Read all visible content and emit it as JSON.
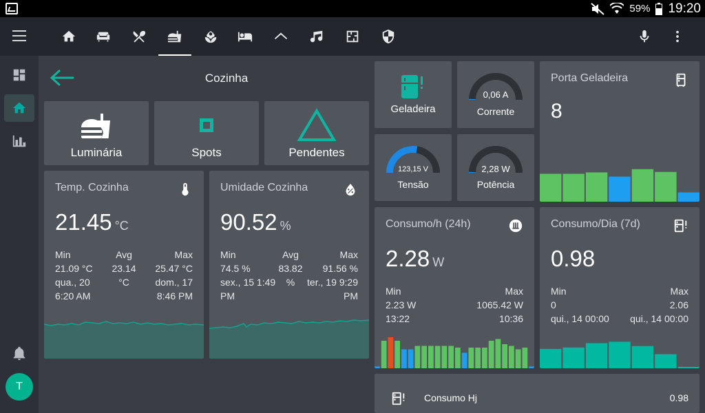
{
  "status_bar": {
    "battery": "59%",
    "time": "19:20"
  },
  "nav": {
    "tabs": [
      "home-icon",
      "sofa-icon",
      "fork-knife-icon",
      "food-drink-icon",
      "flower-icon",
      "bed-icon",
      "roof-icon",
      "music-icon",
      "floorplan-icon",
      "shield-icon"
    ],
    "active_tab": "food-drink-icon"
  },
  "sidebar": {
    "items": [
      "dashboard-icon",
      "home-icon",
      "chart-icon"
    ],
    "user_initial": "T"
  },
  "view": {
    "title": "Cozinha"
  },
  "lights": [
    {
      "label": "Luminária",
      "icon": "food-drink-icon"
    },
    {
      "label": "Spots",
      "icon": "square-icon"
    },
    {
      "label": "Pendentes",
      "icon": "triangle-icon"
    }
  ],
  "temp": {
    "title": "Temp. Cozinha",
    "value": "21.45",
    "unit": "°C",
    "min_label": "Min",
    "avg_label": "Avg",
    "max_label": "Max",
    "min_value": "21.09 °C",
    "min_date": "qua., 20",
    "min_time": "6:20 AM",
    "avg_value": "23.14",
    "avg_unit": "°C",
    "max_value": "25.47 °C",
    "max_date": "dom., 17",
    "max_time": "8:46 PM"
  },
  "humidity": {
    "title": "Umidade Cozinha",
    "value": "90.52",
    "unit": "%",
    "min_label": "Min",
    "avg_label": "Avg",
    "max_label": "Max",
    "min_value": "74.5 %",
    "min_date": "sex., 15 1:49",
    "min_time": "PM",
    "avg_value": "83.82",
    "avg_unit": "%",
    "max_value": "91.56 %",
    "max_date": "ter., 19 9:29",
    "max_time": "PM"
  },
  "fridge": {
    "label": "Geladeira"
  },
  "current": {
    "value": "0,06 A",
    "label": "Corrente",
    "level": 0.01
  },
  "voltage": {
    "value": "123,15 V",
    "label": "Tensão",
    "level": 0.55
  },
  "power": {
    "value": "2,28 W",
    "label": "Potência",
    "level": 0.01
  },
  "door": {
    "title": "Porta Geladeira",
    "value": "8",
    "bars": [
      {
        "value": 6,
        "color": "#5ec463"
      },
      {
        "value": 6,
        "color": "#5ec463"
      },
      {
        "value": 6.3,
        "color": "#5ec463"
      },
      {
        "value": 5.4,
        "color": "#1e9ef0"
      },
      {
        "value": 7,
        "color": "#5ec463"
      },
      {
        "value": 6.4,
        "color": "#5ec463"
      },
      {
        "value": 2,
        "color": "#1e9ef0"
      }
    ]
  },
  "consumo_h": {
    "title": "Consumo/h (24h)",
    "value": "2.28",
    "unit": "W",
    "min_label": "Min",
    "max_label": "Max",
    "min_value": "2.23 W",
    "min_time": "13:22",
    "max_value": "1065.42 W",
    "max_time": "10:36",
    "bars": [
      {
        "value": 1,
        "color": "#1e9ef0"
      },
      {
        "value": 16,
        "color": "#5ec463"
      },
      {
        "value": 18,
        "color": "#e4511e"
      },
      {
        "value": 16,
        "color": "#5ec463"
      },
      {
        "value": 11,
        "color": "#1e9ef0"
      },
      {
        "value": 11,
        "color": "#1e9ef0"
      },
      {
        "value": 13,
        "color": "#5ec463"
      },
      {
        "value": 13,
        "color": "#5ec463"
      },
      {
        "value": 13,
        "color": "#5ec463"
      },
      {
        "value": 13,
        "color": "#5ec463"
      },
      {
        "value": 13,
        "color": "#5ec463"
      },
      {
        "value": 13,
        "color": "#5ec463"
      },
      {
        "value": 12,
        "color": "#5ec463"
      },
      {
        "value": 9,
        "color": "#1e9ef0"
      },
      {
        "value": 12,
        "color": "#5ec463"
      },
      {
        "value": 12,
        "color": "#5ec463"
      },
      {
        "value": 12,
        "color": "#5ec463"
      },
      {
        "value": 16,
        "color": "#5ec463"
      },
      {
        "value": 17,
        "color": "#5ec463"
      },
      {
        "value": 14,
        "color": "#5ec463"
      },
      {
        "value": 13,
        "color": "#5ec463"
      },
      {
        "value": 11,
        "color": "#5ec463"
      },
      {
        "value": 12,
        "color": "#5ec463"
      },
      {
        "value": 1,
        "color": "#1e9ef0"
      }
    ]
  },
  "consumo_d": {
    "title": "Consumo/Dia (7d)",
    "value": "0.98",
    "min_label": "Min",
    "max_label": "Max",
    "min_value": "0",
    "min_time": "qui., 14 00:00",
    "max_value": "2.06",
    "max_time": "qui., 14 00:00",
    "bars": [
      1.35,
      1.45,
      1.75,
      1.85,
      1.55,
      0.98,
      0.05
    ]
  },
  "consumo_hj": {
    "label": "Consumo Hj",
    "value": "0.98"
  }
}
